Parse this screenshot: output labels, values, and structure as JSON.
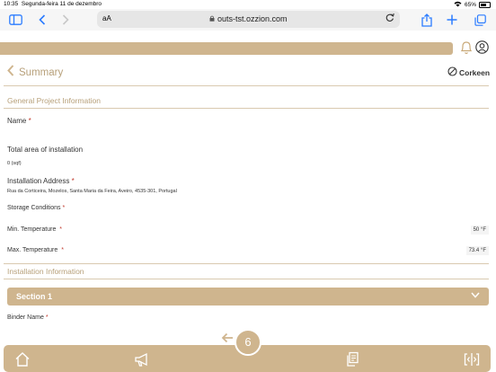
{
  "status_bar": {
    "time": "10:35",
    "date": "Segunda-feira 11 de dezembro",
    "battery": "65%"
  },
  "browser": {
    "aa_label": "aA",
    "url": "outs-tst.ozzion.com"
  },
  "page": {
    "back_title": "Summary",
    "logo_text": "Corkeen",
    "general_section": "General Project Information",
    "name_label": "Name",
    "required_mark": "*",
    "total_area_label": "Total area of installation",
    "total_area_value": "0  (sqf)",
    "address_label": "Installation Address",
    "address_value": "Rua da Corticeira, Mozelos, Santa Maria da Feira, Aveiro, 4535-301, Portugal",
    "storage_label": "Storage Conditions",
    "min_temp_label": "Min. Temperature",
    "min_temp_value": "50 °F",
    "max_temp_label": "Max. Temperature",
    "max_temp_value": "73.4 °F",
    "install_section": "Installation Information",
    "section1": "Section 1",
    "binder_label": "Binder Name",
    "page_number": "6"
  },
  "colors": {
    "accent": "#cfb58e",
    "accent_text": "#b7a07a",
    "required": "#c0392b"
  },
  "icons": [
    "sidebar-icon",
    "back-icon",
    "forward-icon",
    "reload-icon",
    "share-icon",
    "plus-icon",
    "tabs-icon",
    "bell-icon",
    "user-icon",
    "chevron-left-icon",
    "chevron-down-icon",
    "home-icon",
    "megaphone-icon",
    "documents-icon",
    "split-icon",
    "arrow-left-icon"
  ]
}
